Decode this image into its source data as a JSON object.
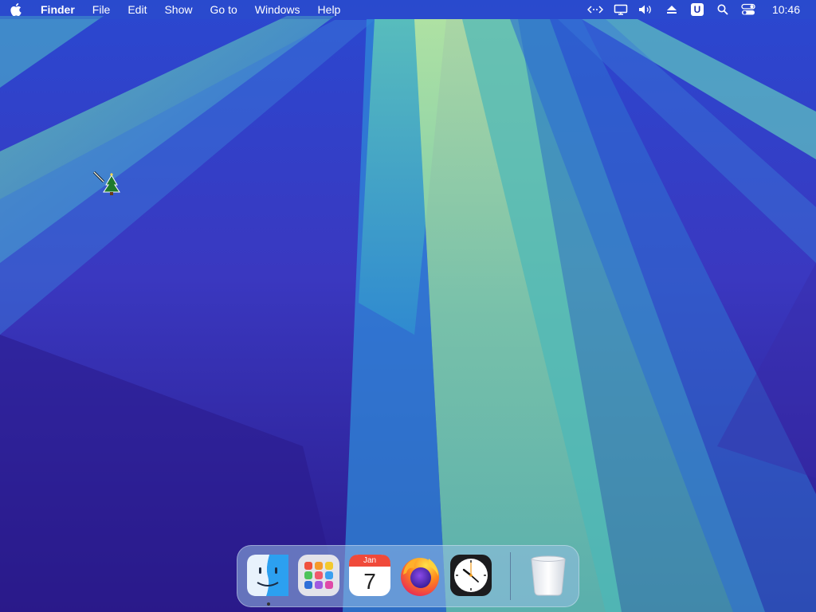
{
  "menubar": {
    "app_name": "Finder",
    "items": [
      "File",
      "Edit",
      "Show",
      "Go to",
      "Windows",
      "Help"
    ],
    "status_icons": [
      "code-icon",
      "display-icon",
      "volume-icon",
      "eject-icon",
      "u-badge-icon",
      "search-icon",
      "control-center-icon"
    ],
    "u_badge": "U",
    "clock": "10:46"
  },
  "dock": {
    "apps": [
      {
        "name": "finder-icon",
        "running": true
      },
      {
        "name": "launchpad-icon",
        "running": false
      },
      {
        "name": "calendar-icon",
        "running": false
      },
      {
        "name": "firefox-icon",
        "running": false
      },
      {
        "name": "clock-app-icon",
        "running": false
      },
      {
        "name": "trash-icon",
        "running": false
      }
    ],
    "calendar_month": "Jan",
    "calendar_day": "7"
  },
  "cursor": {
    "name": "christmas-tree-cursor-icon"
  },
  "colors": {
    "accent": "#1d2fb0",
    "wallpaper_glow": "#a8e0a0"
  }
}
